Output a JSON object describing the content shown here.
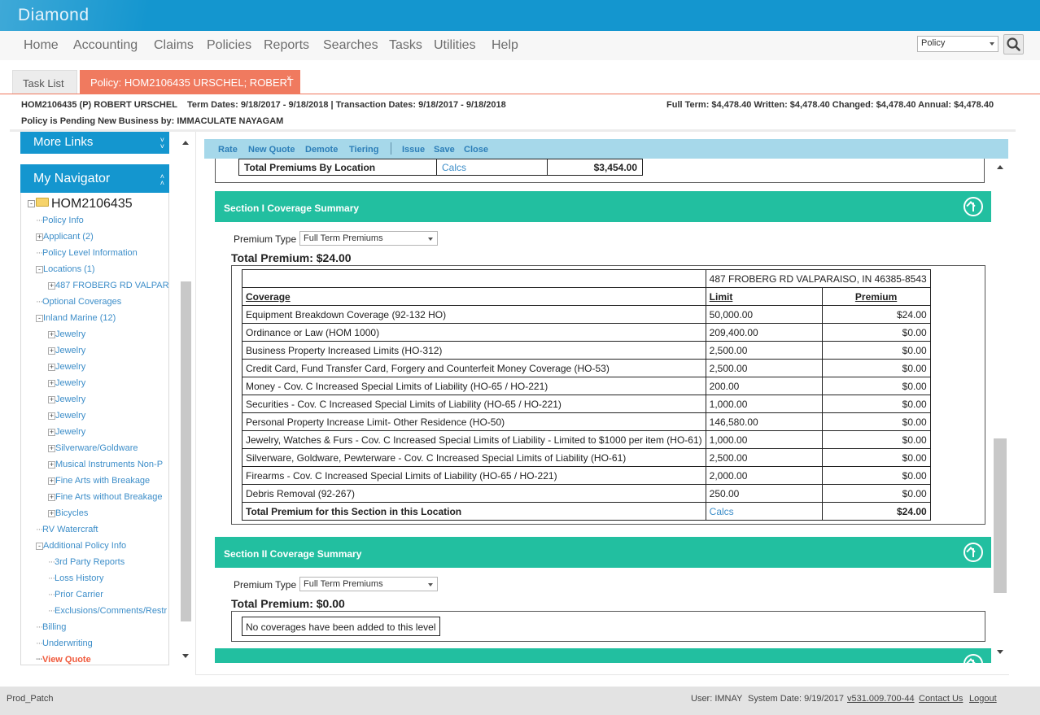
{
  "app": {
    "title": "Diamond"
  },
  "menu": {
    "items": [
      "Home",
      "Accounting",
      "Claims",
      "Policies",
      "Reports",
      "Searches",
      "Tasks",
      "Utilities",
      "Help"
    ],
    "search_type": "Policy"
  },
  "tabs": {
    "task_list": "Task List",
    "policy": "Policy: HOM2106435 URSCHEL; ROBERT",
    "close": "×"
  },
  "policy_info": {
    "number_name": "HOM2106435 (P)  ROBERT URSCHEL",
    "dates": "Term Dates:  9/18/2017 - 9/18/2018 | Transaction Dates: 9/18/2017 - 9/18/2018",
    "premiums": "Full Term: $4,478.40  Written: $4,478.40  Changed: $4,478.40  Annual: $4,478.40",
    "pending": "Policy is Pending New Business by: IMMACULATE NAYAGAM"
  },
  "left": {
    "more_links": "More Links",
    "my_navigator": "My Navigator",
    "root": "HOM2106435",
    "items": [
      {
        "label": "Policy Info",
        "pm": ""
      },
      {
        "label": "Applicant (2)",
        "pm": "+"
      },
      {
        "label": "Policy Level Information",
        "pm": ""
      },
      {
        "label": "Locations (1)",
        "pm": "-"
      },
      {
        "label": "487 FROBERG RD VALPARA",
        "pm": "+"
      },
      {
        "label": "Optional Coverages",
        "pm": ""
      },
      {
        "label": "Inland Marine (12)",
        "pm": "-"
      },
      {
        "label": "Jewelry",
        "pm": "+"
      },
      {
        "label": "Jewelry",
        "pm": "+"
      },
      {
        "label": "Jewelry",
        "pm": "+"
      },
      {
        "label": "Jewelry",
        "pm": "+"
      },
      {
        "label": "Jewelry",
        "pm": "+"
      },
      {
        "label": "Jewelry",
        "pm": "+"
      },
      {
        "label": "Jewelry",
        "pm": "+"
      },
      {
        "label": "Silverware/Goldware",
        "pm": "+"
      },
      {
        "label": "Musical Instruments Non-P",
        "pm": "+"
      },
      {
        "label": "Fine Arts with Breakage",
        "pm": "+"
      },
      {
        "label": "Fine Arts without Breakage",
        "pm": "+"
      },
      {
        "label": "Bicycles",
        "pm": "+"
      },
      {
        "label": "RV Watercraft",
        "pm": ""
      },
      {
        "label": "Additional Policy Info",
        "pm": "-"
      },
      {
        "label": "3rd Party Reports",
        "pm": ""
      },
      {
        "label": "Loss History",
        "pm": ""
      },
      {
        "label": "Prior Carrier",
        "pm": ""
      },
      {
        "label": "Exclusions/Comments/Restr",
        "pm": ""
      },
      {
        "label": "Billing",
        "pm": ""
      },
      {
        "label": "Underwriting",
        "pm": ""
      },
      {
        "label": "View Quote",
        "pm": ""
      }
    ]
  },
  "toolbar": [
    "Rate",
    "New Quote",
    "Demote",
    "Tiering",
    "Issue",
    "Save",
    "Close"
  ],
  "location_totals": {
    "label": "Total Premiums By Location",
    "calcs": "Calcs",
    "amount": "$3,454.00"
  },
  "section1": {
    "title": "Section I Coverage Summary",
    "premium_type_label": "Premium Type",
    "premium_type_value": "Full Term Premiums",
    "total_premium": "Total Premium: $24.00",
    "location": "487 FROBERG RD VALPARAISO, IN 46385-8543",
    "headers": [
      "Coverage",
      "Limit",
      "Premium"
    ],
    "rows": [
      [
        "Equipment Breakdown Coverage (92-132 HO)",
        "50,000.00",
        "$24.00"
      ],
      [
        "Ordinance or Law (HOM 1000)",
        "209,400.00",
        "$0.00"
      ],
      [
        "Business Property Increased Limits (HO-312)",
        "2,500.00",
        "$0.00"
      ],
      [
        "Credit Card, Fund Transfer Card, Forgery and Counterfeit Money Coverage (HO-53)",
        "2,500.00",
        "$0.00"
      ],
      [
        "Money - Cov. C Increased Special Limits of Liability (HO-65 / HO-221)",
        "200.00",
        "$0.00"
      ],
      [
        "Securities - Cov. C Increased Special Limits of Liability (HO-65 / HO-221)",
        "1,000.00",
        "$0.00"
      ],
      [
        "Personal Property Increase Limit- Other Residence (HO-50)",
        "146,580.00",
        "$0.00"
      ],
      [
        "Jewelry, Watches & Furs - Cov. C Increased Special Limits of Liability - Limited to $1000 per item (HO-61)",
        "1,000.00",
        "$0.00"
      ],
      [
        "Silverware, Goldware, Pewterware - Cov. C Increased Special Limits of Liability (HO-61)",
        "2,500.00",
        "$0.00"
      ],
      [
        "Firearms - Cov. C Increased Special Limits of Liability (HO-65 / HO-221)",
        "2,000.00",
        "$0.00"
      ],
      [
        "Debris Removal (92-267)",
        "250.00",
        "$0.00"
      ]
    ],
    "total_label": "Total Premium for this Section in this Location",
    "total_calcs": "Calcs",
    "total_amount": "$24.00"
  },
  "section2": {
    "title": "Section II Coverage Summary",
    "premium_type_label": "Premium Type",
    "premium_type_value": "Full Term Premiums",
    "total_premium": "Total Premium: $0.00",
    "no_coverages": "No coverages have been added to this level"
  },
  "footer": {
    "env": "Prod_Patch",
    "user": "User: IMNAY",
    "system_date": "System Date: 9/19/2017",
    "version": "v531.009.700-44",
    "contact": "Contact Us",
    "logout": "Logout"
  },
  "colors": {
    "brand": "#1496cf",
    "tab_active": "#f07a5f",
    "section_header": "#22bfa0",
    "toolbar": "#a6d8ea",
    "link": "#3d8ec9"
  },
  "icons": [
    "search-icon",
    "folder-icon",
    "chevron-up-icon",
    "chevron-down-icon",
    "arrow-up-circle-icon"
  ]
}
